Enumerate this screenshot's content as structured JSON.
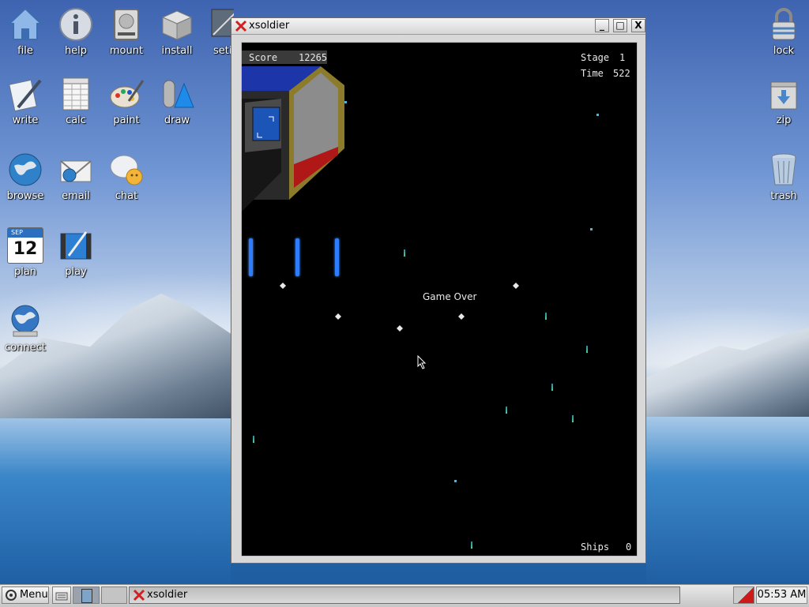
{
  "desktop": {
    "icons_left": [
      {
        "label": "file",
        "icon": "home-folder-icon"
      },
      {
        "label": "help",
        "icon": "info-icon"
      },
      {
        "label": "mount",
        "icon": "drive-icon"
      },
      {
        "label": "install",
        "icon": "package-box-icon"
      },
      {
        "label": "seti",
        "icon": "seti-icon"
      },
      {
        "label": "write",
        "icon": "write-document-icon"
      },
      {
        "label": "calc",
        "icon": "spreadsheet-icon"
      },
      {
        "label": "paint",
        "icon": "palette-icon"
      },
      {
        "label": "draw",
        "icon": "shapes-icon"
      },
      {
        "label": "browse",
        "icon": "globe-icon"
      },
      {
        "label": "email",
        "icon": "envelope-icon"
      },
      {
        "label": "chat",
        "icon": "chat-bubble-icon"
      },
      {
        "label": "plan",
        "icon": "calendar-icon",
        "calendar_month": "SEP",
        "calendar_day": "12"
      },
      {
        "label": "play",
        "icon": "media-player-icon"
      },
      {
        "label": "connect",
        "icon": "network-globe-icon"
      }
    ],
    "icons_right": [
      {
        "label": "lock",
        "icon": "padlock-icon"
      },
      {
        "label": "zip",
        "icon": "archive-icon"
      },
      {
        "label": "trash",
        "icon": "trash-bin-icon"
      }
    ]
  },
  "window": {
    "title": "xsoldier",
    "controls": {
      "minimize": "_",
      "maximize": "□",
      "close": "X"
    }
  },
  "game": {
    "score_label": "Score",
    "score_value": "12265",
    "stage_label": "Stage",
    "stage_value": "1",
    "time_label": "Time",
    "time_value": "522",
    "status_message": "Game Over",
    "ships_label": "Ships",
    "ships_value": "0"
  },
  "taskbar": {
    "menu_label": "Menu",
    "task_label": "xsoldier",
    "clock": "05:53 AM"
  },
  "colors": {
    "game_background": "#000000",
    "beam": "#2e7dff",
    "accent_red": "#cc1a1a"
  }
}
